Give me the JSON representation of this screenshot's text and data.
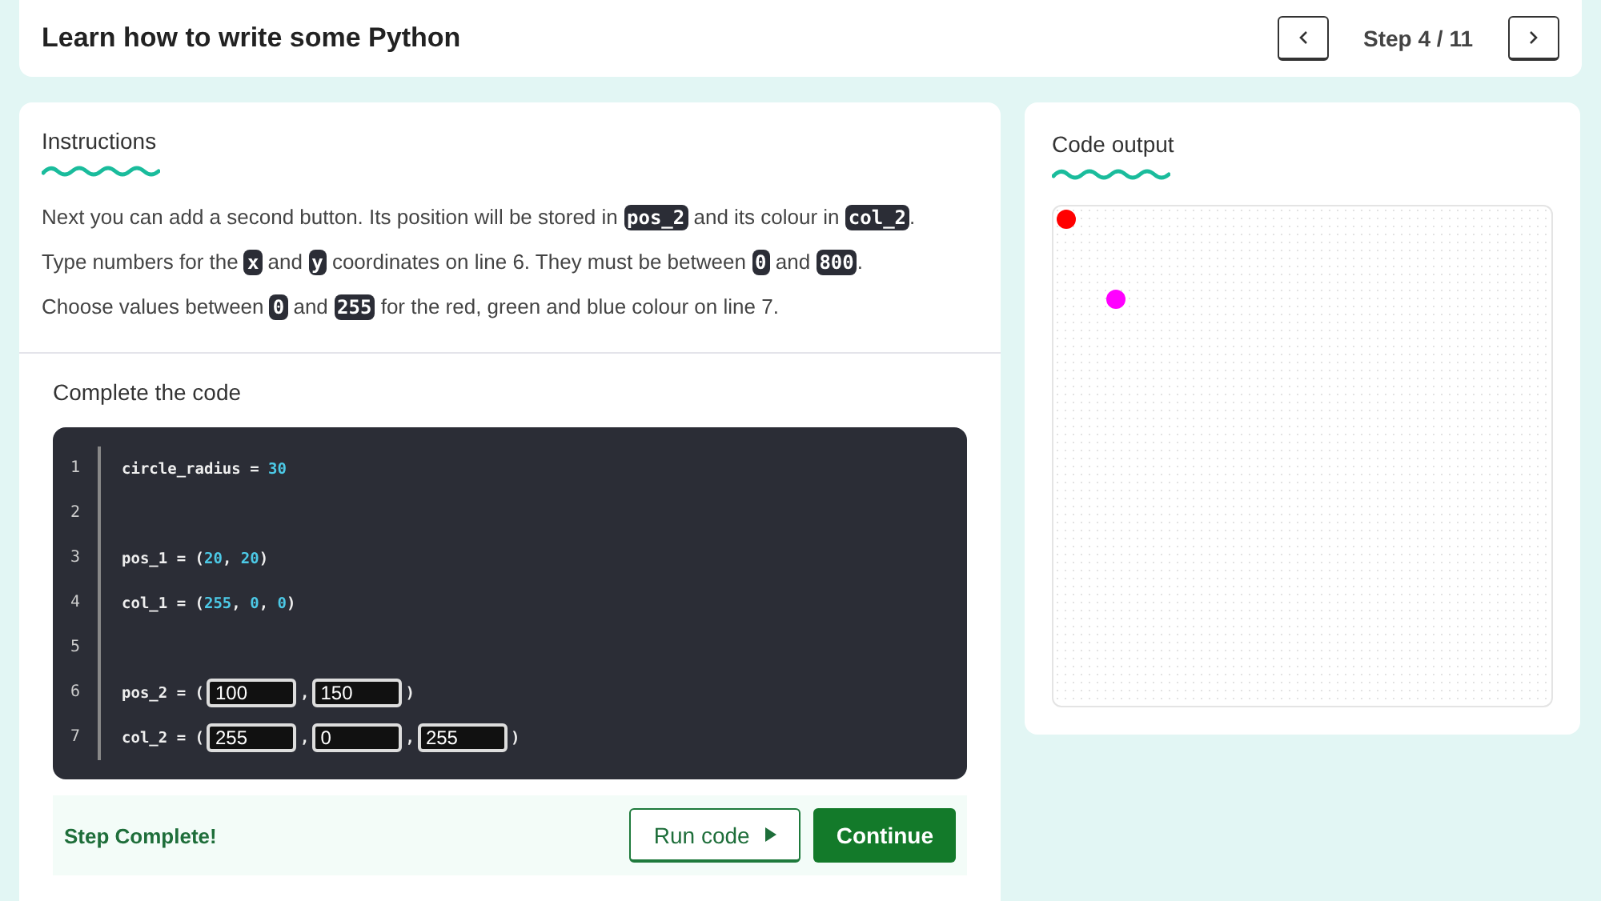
{
  "header": {
    "title": "Learn how to write some Python",
    "step": "Step 4 / 11"
  },
  "instructions": {
    "title": "Instructions",
    "paragraphs": [
      [
        {
          "kind": "text",
          "text": "Next you can add a second button. Its position will be stored in "
        },
        {
          "kind": "code",
          "text": "pos_2"
        },
        {
          "kind": "text",
          "text": " and its colour in "
        },
        {
          "kind": "code",
          "text": "col_2"
        },
        {
          "kind": "text",
          "text": "."
        }
      ],
      [
        {
          "kind": "text",
          "text": "Type numbers for the "
        },
        {
          "kind": "code",
          "text": "x"
        },
        {
          "kind": "text",
          "text": " and "
        },
        {
          "kind": "code",
          "text": "y"
        },
        {
          "kind": "text",
          "text": " coordinates on line 6. They must be between "
        },
        {
          "kind": "code",
          "text": "0"
        },
        {
          "kind": "text",
          "text": " and "
        },
        {
          "kind": "code",
          "text": "800"
        },
        {
          "kind": "text",
          "text": "."
        }
      ],
      [
        {
          "kind": "text",
          "text": "Choose values between "
        },
        {
          "kind": "code",
          "text": "0"
        },
        {
          "kind": "text",
          "text": " and "
        },
        {
          "kind": "code",
          "text": "255"
        },
        {
          "kind": "text",
          "text": " for the red, green and blue colour on line 7."
        }
      ]
    ]
  },
  "editor": {
    "title": "Complete the code",
    "lines": [
      {
        "number": "1",
        "tokens": [
          {
            "kind": "plain",
            "text": "circle_radius = "
          },
          {
            "kind": "number",
            "text": "30"
          }
        ]
      },
      {
        "number": "2"
      },
      {
        "number": "3",
        "tokens": [
          {
            "kind": "plain",
            "text": "pos_1 = ("
          },
          {
            "kind": "number",
            "text": "20"
          },
          {
            "kind": "plain",
            "text": ", "
          },
          {
            "kind": "number",
            "text": "20"
          },
          {
            "kind": "plain",
            "text": ")"
          }
        ]
      },
      {
        "number": "4",
        "tokens": [
          {
            "kind": "plain",
            "text": "col_1 = ("
          },
          {
            "kind": "number",
            "text": "255"
          },
          {
            "kind": "plain",
            "text": ", "
          },
          {
            "kind": "number",
            "text": "0"
          },
          {
            "kind": "plain",
            "text": ", "
          },
          {
            "kind": "number",
            "text": "0"
          },
          {
            "kind": "plain",
            "text": ")"
          }
        ]
      },
      {
        "number": "5"
      },
      {
        "number": "6",
        "tokens": [
          {
            "kind": "plain",
            "text": "pos_2 = ("
          },
          {
            "kind": "input",
            "text": "100"
          },
          {
            "kind": "plain",
            "text": ","
          },
          {
            "kind": "input",
            "text": "150"
          },
          {
            "kind": "plain",
            "text": ")"
          }
        ]
      },
      {
        "number": "7",
        "tokens": [
          {
            "kind": "plain",
            "text": "col_2 = ("
          },
          {
            "kind": "input",
            "text": "255"
          },
          {
            "kind": "plain",
            "text": ","
          },
          {
            "kind": "input",
            "text": "0"
          },
          {
            "kind": "plain",
            "text": ","
          },
          {
            "kind": "input",
            "text": "255"
          },
          {
            "kind": "plain",
            "text": ")"
          }
        ]
      }
    ]
  },
  "footer": {
    "status": "Step Complete!",
    "run_button": "Run code",
    "continue_button": "Continue"
  },
  "output": {
    "title": "Code output",
    "circles": [
      {
        "color": "#ff0000"
      },
      {
        "color": "#ff00ff"
      }
    ]
  }
}
